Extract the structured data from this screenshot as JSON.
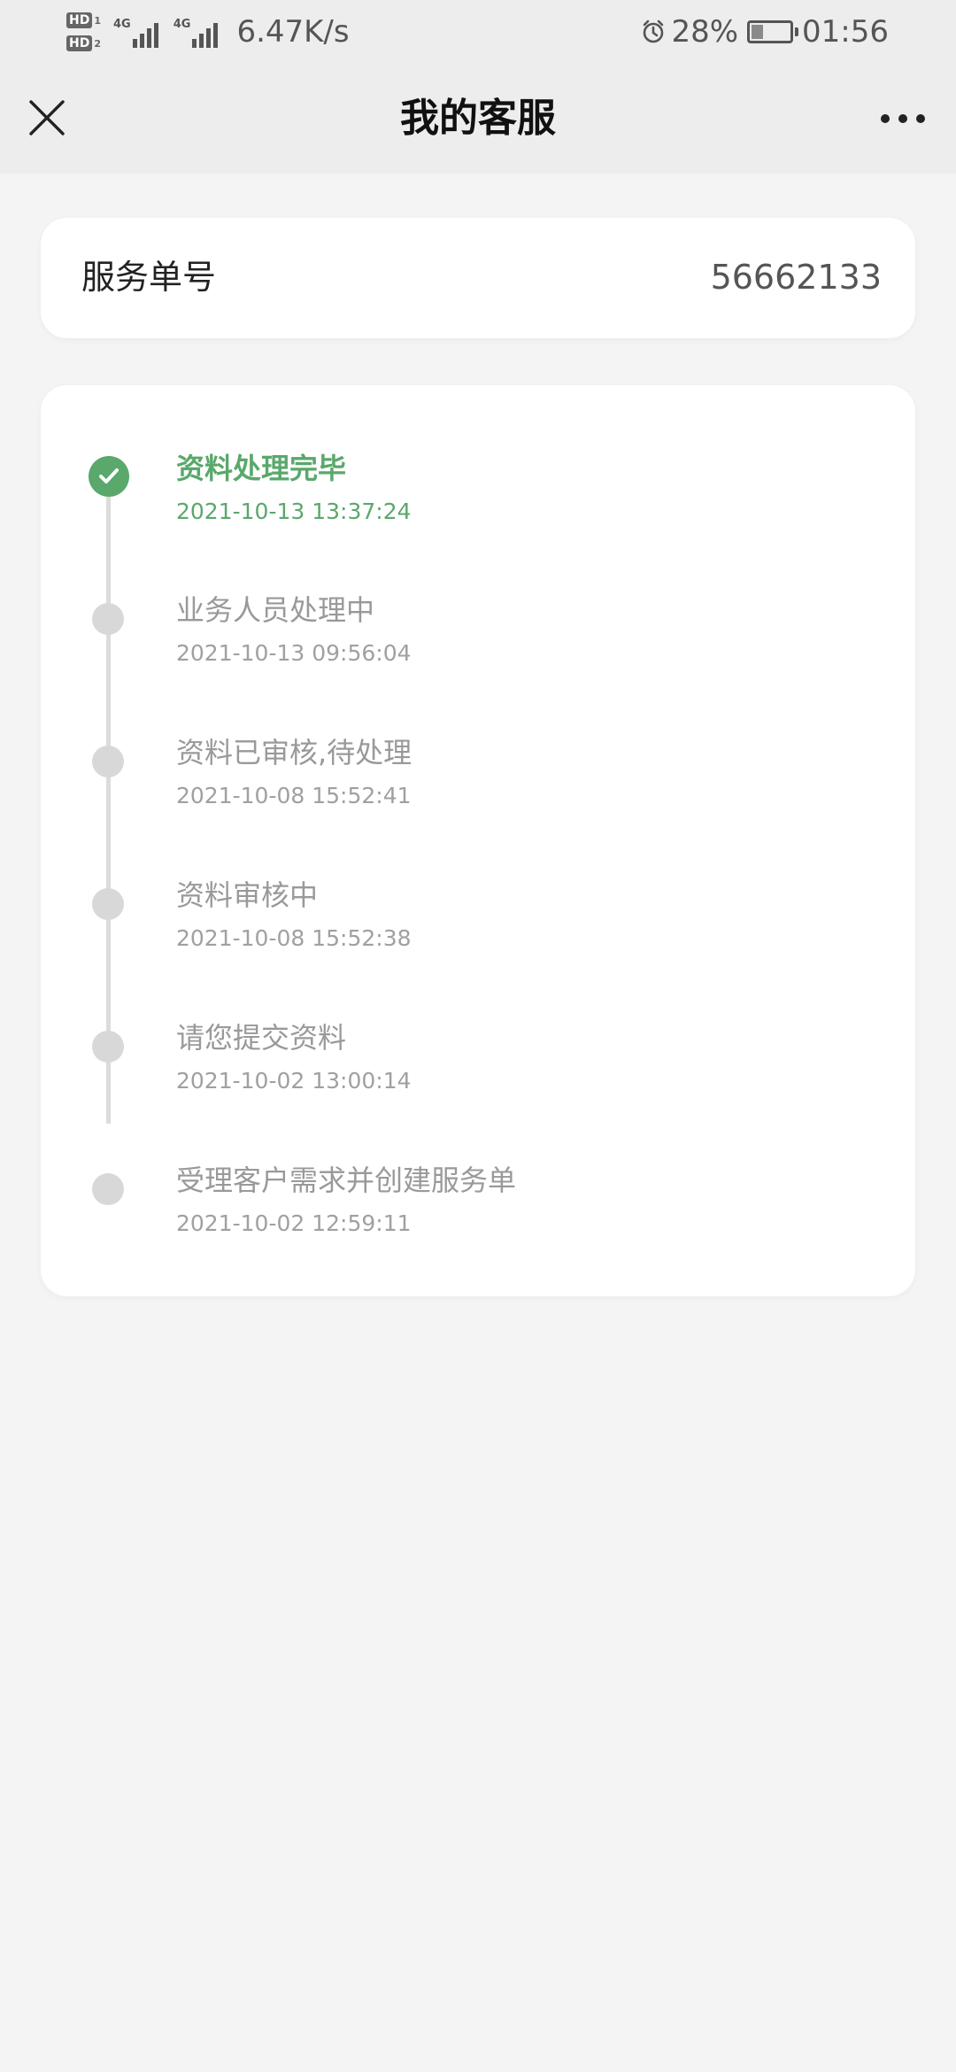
{
  "status_bar": {
    "sim1_label": "HD",
    "sim1_num": "1",
    "sim2_label": "HD",
    "sim2_num": "2",
    "network1": "4G",
    "network2": "4G",
    "net_speed": "6.47K/s",
    "battery_percent": "28%",
    "battery_level": 0.28,
    "time": "01:56"
  },
  "header": {
    "title": "我的客服",
    "close_icon": "close-icon",
    "more_icon": "more-icon"
  },
  "order": {
    "label": "服务单号",
    "number": "56662133"
  },
  "timeline": [
    {
      "title": "资料处理完毕",
      "time": "2021-10-13 13:37:24",
      "done": true
    },
    {
      "title": "业务人员处理中",
      "time": "2021-10-13 09:56:04",
      "done": false
    },
    {
      "title": "资料已审核,待处理",
      "time": "2021-10-08 15:52:41",
      "done": false
    },
    {
      "title": "资料审核中",
      "time": "2021-10-08 15:52:38",
      "done": false
    },
    {
      "title": "请您提交资料",
      "time": "2021-10-02 13:00:14",
      "done": false
    },
    {
      "title": "受理客户需求并创建服务单",
      "time": "2021-10-02 12:59:11",
      "done": false
    }
  ],
  "colors": {
    "accent_green": "#5aa86b",
    "inactive_gray": "#999999",
    "background": "#f4f4f4"
  }
}
